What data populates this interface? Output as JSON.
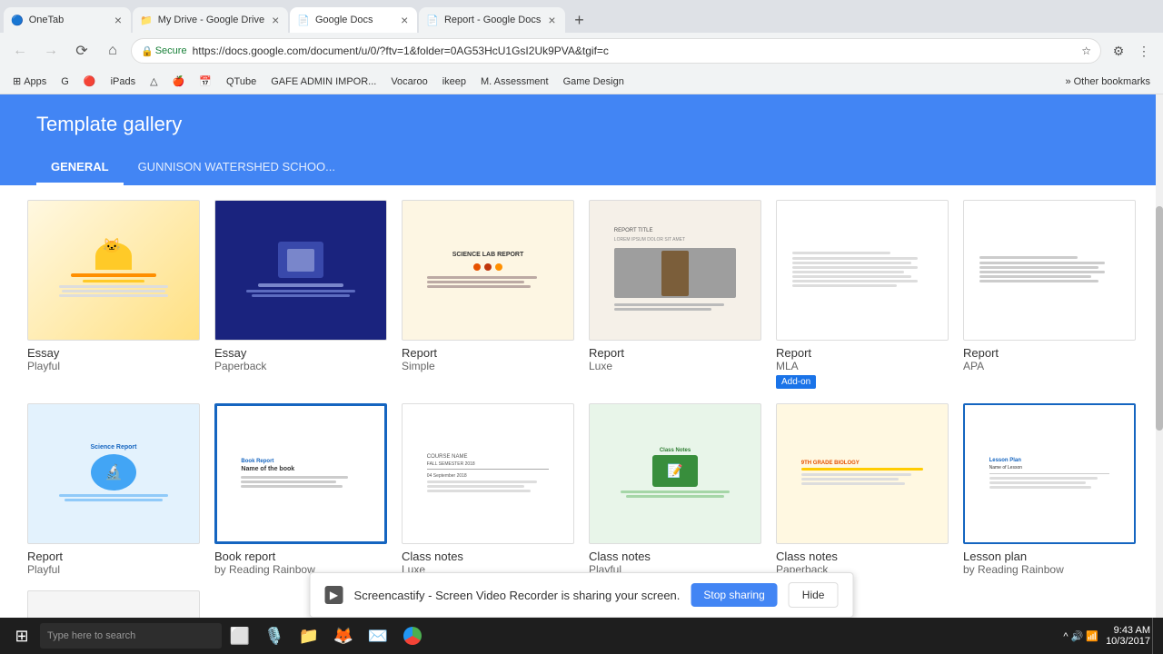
{
  "browser": {
    "tabs": [
      {
        "id": "onetab",
        "label": "OneTab",
        "icon": "🔵",
        "active": false
      },
      {
        "id": "my-drive",
        "label": "My Drive - Google Drive",
        "icon": "📁",
        "active": false
      },
      {
        "id": "google-docs",
        "label": "Google Docs",
        "icon": "📄",
        "active": true
      },
      {
        "id": "report-google-docs",
        "label": "Report - Google Docs",
        "icon": "📄",
        "active": false
      }
    ],
    "address": "https://docs.google.com/document/u/0/?ftv=1&folder=0AG53HcU1GsI2Uk9PVA&tgif=c",
    "secure_label": "Secure"
  },
  "bookmarks": [
    {
      "label": "Apps"
    },
    {
      "label": "G",
      "icon": "🟡"
    },
    {
      "label": "iPads"
    },
    {
      "label": "QTube"
    },
    {
      "label": "GAFE ADMIN IMPOR..."
    },
    {
      "label": "Vocaroo"
    },
    {
      "label": "ikeep"
    },
    {
      "label": "M. Assessment"
    },
    {
      "label": "Game Design"
    },
    {
      "label": "Other bookmarks"
    }
  ],
  "page": {
    "title": "Template gallery",
    "tabs": [
      {
        "label": "GENERAL",
        "active": true
      },
      {
        "label": "GUNNISON WATERSHED SCHOO...",
        "active": false
      }
    ]
  },
  "templates_row1": [
    {
      "name": "Essay",
      "subtitle": "Playful",
      "style": "essay-playful",
      "addon": false
    },
    {
      "name": "Essay",
      "subtitle": "Paperback",
      "style": "essay-paperback",
      "addon": false
    },
    {
      "name": "Report",
      "subtitle": "Simple",
      "style": "report-simple",
      "addon": false
    },
    {
      "name": "Report",
      "subtitle": "Luxe",
      "style": "report-luxe",
      "addon": false
    },
    {
      "name": "Report",
      "subtitle": "MLA",
      "style": "report-mla",
      "addon": true,
      "addon_label": "Add-on"
    },
    {
      "name": "Report",
      "subtitle": "APA",
      "style": "report-apa",
      "addon": false
    }
  ],
  "templates_row2": [
    {
      "name": "Report",
      "subtitle": "Playful",
      "style": "report-playful",
      "addon": false
    },
    {
      "name": "Book report",
      "subtitle": "by Reading Rainbow",
      "style": "book-report",
      "addon": false
    },
    {
      "name": "Class notes",
      "subtitle": "Luxe",
      "style": "class-notes-luxe",
      "addon": false
    },
    {
      "name": "Class notes",
      "subtitle": "Playful",
      "style": "class-notes-playful",
      "addon": false
    },
    {
      "name": "Class notes",
      "subtitle": "Paperback",
      "style": "class-notes-paperback",
      "addon": false
    },
    {
      "name": "Lesson plan",
      "subtitle": "by Reading Rainbow",
      "style": "lesson-plan",
      "addon": false
    }
  ],
  "screencastify": {
    "message": "Screencastify - Screen Video Recorder is sharing your screen.",
    "stop_sharing": "Stop sharing",
    "hide": "Hide"
  },
  "taskbar": {
    "search_placeholder": "Type here to search",
    "time": "9:43 AM",
    "date": "10/3/2017",
    "items": [
      "🎙️",
      "⬜",
      "📁",
      "🦊",
      "✉️",
      "🌐"
    ]
  }
}
